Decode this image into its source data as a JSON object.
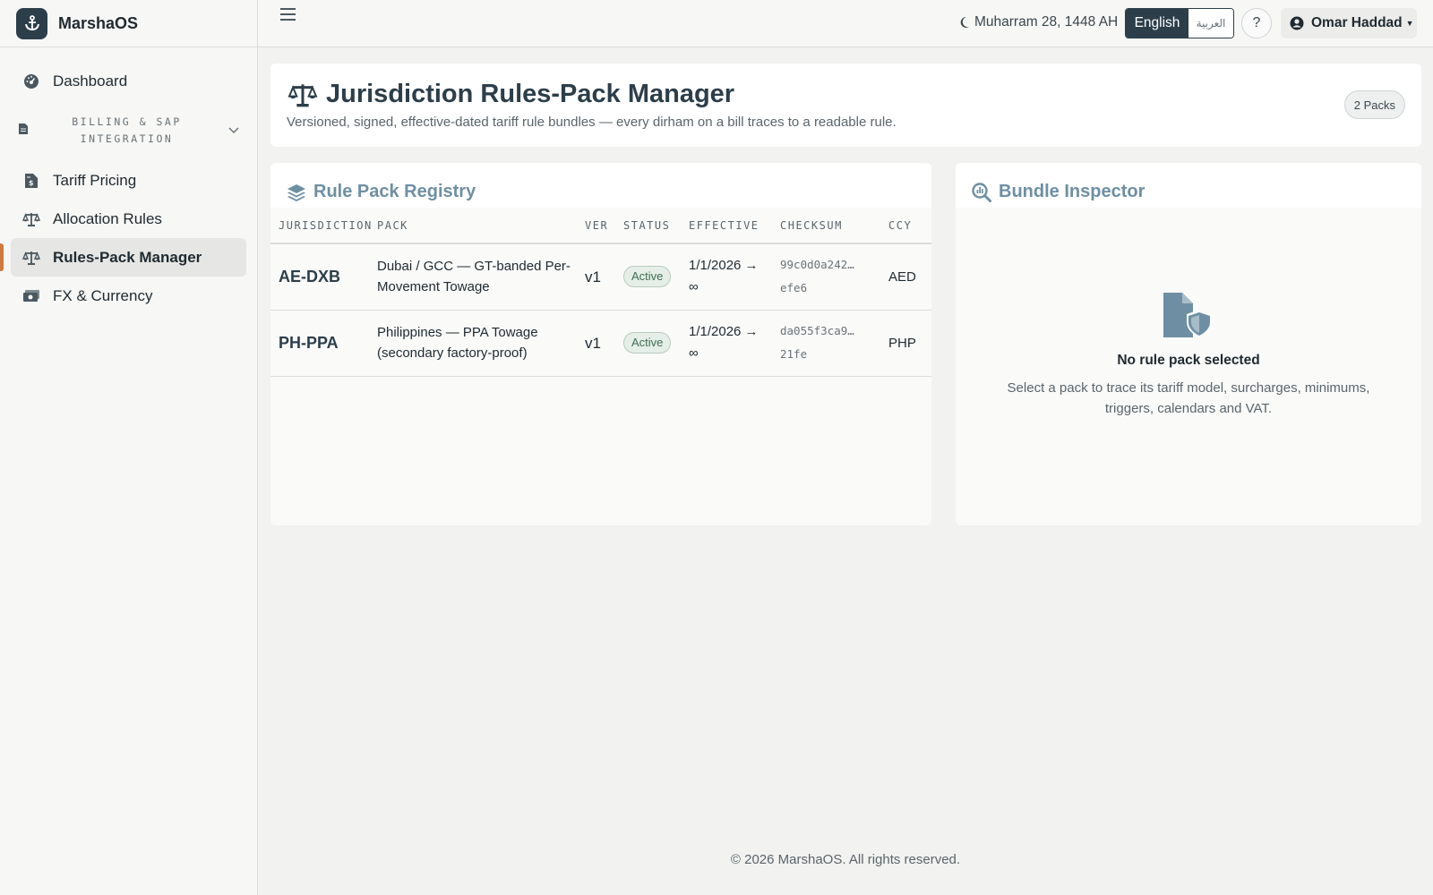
{
  "brand": {
    "name": "MarshaOS"
  },
  "sidebar": {
    "items": [
      {
        "label": "Dashboard",
        "icon": "gauge-icon"
      },
      {
        "label": "Tariff Pricing",
        "icon": "invoice-dollar-icon"
      },
      {
        "label": "Allocation Rules",
        "icon": "scale-icon"
      },
      {
        "label": "Rules-Pack Manager",
        "icon": "scale-icon",
        "active": true
      },
      {
        "label": "FX & Currency",
        "icon": "money-bill-icon"
      }
    ],
    "section": {
      "label": "BILLING & SAP INTEGRATION",
      "icon": "file-icon"
    }
  },
  "topbar": {
    "hijri_date": "Muharram 28, 1448 AH",
    "lang_en": "English",
    "lang_ar": "العربية",
    "help": "?",
    "user_name": "Omar Haddad"
  },
  "header": {
    "title": "Jurisdiction Rules-Pack Manager",
    "subtitle": "Versioned, signed, effective-dated tariff rule bundles — every dirham on a bill traces to a readable rule.",
    "badge": "2 Packs"
  },
  "registry": {
    "title": "Rule Pack Registry",
    "columns": [
      "JURISDICTION",
      "PACK",
      "VER",
      "STATUS",
      "EFFECTIVE",
      "CHECKSUM",
      "CCY"
    ],
    "rows": [
      {
        "jurisdiction": "AE-DXB",
        "pack": "Dubai / GCC — GT-banded Per-Movement Towage",
        "ver": "v1",
        "status": "Active",
        "effective_from": "1/1/2026 →",
        "effective_to": "∞",
        "checksum_a": "99c0d0a242…",
        "checksum_b": "efe6",
        "ccy": "AED"
      },
      {
        "jurisdiction": "PH-PPA",
        "pack": "Philippines — PPA Towage (secondary factory-proof)",
        "ver": "v1",
        "status": "Active",
        "effective_from": "1/1/2026 →",
        "effective_to": "∞",
        "checksum_a": "da055f3ca9…",
        "checksum_b": "21fe",
        "ccy": "PHP"
      }
    ]
  },
  "inspector": {
    "title": "Bundle Inspector",
    "empty_title": "No rule pack selected",
    "empty_text": "Select a pack to trace its tariff model, surcharges, minimums, triggers, calendars and VAT."
  },
  "footer": {
    "text": "© 2026 MarshaOS. All rights reserved."
  },
  "colors": {
    "brand": "#2c3e4a",
    "accent": "#d17a3c",
    "card_title": "#6e8fa3",
    "active_badge": "#3f6e52"
  }
}
